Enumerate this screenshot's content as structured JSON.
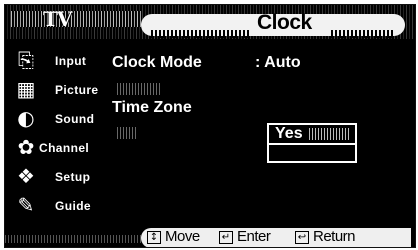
{
  "header": {
    "brand": "TV",
    "title": "Clock"
  },
  "menu": {
    "items": [
      {
        "label": "Input",
        "icon": "input-icon"
      },
      {
        "label": "Picture",
        "icon": "picture-icon"
      },
      {
        "label": "Sound",
        "icon": "sound-icon"
      },
      {
        "label": "Channel",
        "icon": "channel-icon"
      },
      {
        "label": "Setup",
        "icon": "setup-icon"
      },
      {
        "label": "Guide",
        "icon": "guide-icon"
      }
    ]
  },
  "content": {
    "clock_mode": {
      "label": "Clock Mode",
      "value": ": Auto"
    },
    "time_zone": {
      "label": "Time Zone"
    },
    "confirm": {
      "option": "Yes"
    }
  },
  "footer": {
    "move": "Move",
    "enter": "Enter",
    "return": "Return"
  }
}
